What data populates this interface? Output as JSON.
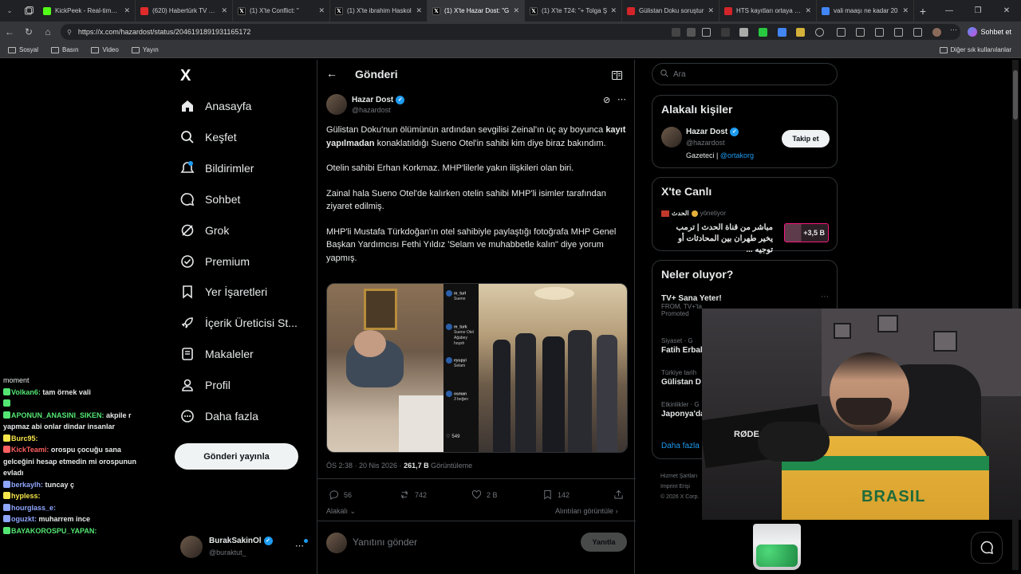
{
  "browser": {
    "tabs": [
      {
        "title": "KickPeek - Real-time U",
        "color": "#53fc18"
      },
      {
        "title": "(620) Habertürk TV Can",
        "color": "#e02b2b"
      },
      {
        "title": "(1) X'te Conflict: \"",
        "color": "#000000"
      },
      {
        "title": "(1) X'te ibrahim Haskol",
        "color": "#000000"
      },
      {
        "title": "(1) X'te Hazar Dost: \"G",
        "color": "#000000"
      },
      {
        "title": "(1) X'te T24: \"+ Tolga Ş",
        "color": "#000000"
      },
      {
        "title": "Gülistan Doku soruştur",
        "color": "#d3242a"
      },
      {
        "title": "HTS kayıtları ortaya çık",
        "color": "#d3242a"
      },
      {
        "title": "vali maaşı ne kadar 20",
        "color": "#4285f4"
      }
    ],
    "url": "https://x.com/hazardost/status/2046191891931165172",
    "chat_button": "Sohbet et",
    "bookmarks": [
      "Sosyal",
      "Basın",
      "Video",
      "Yayın"
    ],
    "bookmarks_other": "Diğer sık kullanılanlar"
  },
  "nav": {
    "logo": "X",
    "items": [
      {
        "label": "Anasayfa",
        "icon": "home-icon"
      },
      {
        "label": "Keşfet",
        "icon": "search-icon"
      },
      {
        "label": "Bildirimler",
        "icon": "bell-icon"
      },
      {
        "label": "Sohbet",
        "icon": "chat-icon"
      },
      {
        "label": "Grok",
        "icon": "grok-icon"
      },
      {
        "label": "Premium",
        "icon": "premium-icon"
      },
      {
        "label": "Yer İşaretleri",
        "icon": "bookmark-icon"
      },
      {
        "label": "İçerik Üreticisi St...",
        "icon": "rocket-icon"
      },
      {
        "label": "Makaleler",
        "icon": "article-icon"
      },
      {
        "label": "Profil",
        "icon": "profile-icon"
      },
      {
        "label": "Daha fazla",
        "icon": "more-icon"
      }
    ],
    "post_button": "Gönderi yayınla",
    "profile": {
      "name": "BurakSakinOl",
      "handle": "@buraktut_"
    }
  },
  "chat": [
    {
      "user": "",
      "text": "moment",
      "color": "#e7e9ea"
    },
    {
      "user": "Volkan6:",
      "text": " tam örnek vali",
      "color": "#54e673"
    },
    {
      "user": "",
      "text": "",
      "color": "#e7e9ea"
    },
    {
      "user": "APONUN_ANASINI_SIKEN:",
      "text": " akpile r yapmaz abi onlar dindar insanlar",
      "color": "#54e673"
    },
    {
      "user": "Burc95:",
      "text": "",
      "color": "#f7e64b"
    },
    {
      "user": "KickTeami:",
      "text": " orospu çocuğu sana gelceğini hesap etmedin mi orospunun evladı",
      "color": "#ff6060"
    },
    {
      "user": "berkaylh:",
      "text": " tuncay ç",
      "color": "#8fa6ff"
    },
    {
      "user": "hypless:",
      "text": "",
      "color": "#f7e64b"
    },
    {
      "user": "hourglass_e:",
      "text": "",
      "color": "#8fa6ff"
    },
    {
      "user": "oguzkt:",
      "text": " muharrem ince",
      "color": "#8fa6ff"
    },
    {
      "user": "BAYAKOROSPU_YAPAN:",
      "text": "",
      "color": "#54e673"
    }
  ],
  "post": {
    "header": "Gönderi",
    "author": "Hazar Dost",
    "handle": "@hazardost",
    "paragraphs": [
      {
        "pre": "Gülistan Doku'nun ölümünün ardından sevgilisi Zeinal'ın üç ay boyunca ",
        "bold": "kayıt yapılmadan",
        "post": " konaklatıldığı Sueno Otel'in sahibi kim diye biraz bakındım."
      },
      {
        "pre": "Otelin sahibi Erhan Korkmaz. MHP'lilerle yakın ilişkileri olan biri.",
        "bold": "",
        "post": ""
      },
      {
        "pre": "Zainal hala Sueno Otel'de kalırken otelin sahibi MHP'li isimler tarafından ziyaret edilmiş.",
        "bold": "",
        "post": ""
      },
      {
        "pre": "MHP'li Mustafa Türkdoğan'ın otel sahibiyle paylaştığı fotoğrafa MHP Genel Başkan Yardımcısı Fethi Yıldız 'Selam ve muhabbetle kalın\" diye yorum yapmış.",
        "bold": "",
        "post": ""
      }
    ],
    "image_comments": [
      {
        "user": "m_turl",
        "text": "Sueno"
      },
      {
        "user": "m_turk",
        "text": "Sueno Otel Ağabey hoşsh"
      },
      {
        "user": "eyupyi",
        "text": "Selam"
      },
      {
        "user": "osman",
        "text": "3 beğen"
      }
    ],
    "image_likes": "549",
    "time": "ÖS 2:38 · 20 Nis 2026 · ",
    "views": "261,7 B",
    "views_label": " Görüntüleme",
    "replies": "56",
    "reposts": "742",
    "likes": "2 B",
    "bookmarks": "142",
    "relevant": "Alakalı",
    "quotes": "Alıntıları görüntüle",
    "reply_placeholder": "Yanıtını gönder",
    "reply_button": "Yanıtla"
  },
  "right": {
    "search_placeholder": "Ara",
    "related_title": "Alakalı kişiler",
    "related": {
      "name": "Hazar Dost",
      "handle": "@hazardost",
      "bio": "Gazeteci | ",
      "bio_link": "@ortakorg",
      "follow": "Takip et"
    },
    "live_title": "X'te Canlı",
    "live": {
      "channel": "الحدث",
      "status": "yönetiyor",
      "text": "مباشر من قناة الحدث | ترمب يخير طهران بين المحادثات أو توجيه ...",
      "count": "+3,5 B"
    },
    "trends_title": "Neler oluyor?",
    "trends": [
      {
        "meta": "",
        "title": "TV+ Sana Yeter!",
        "sub": "FROM, TV+'ta",
        "extra": "Promoted"
      },
      {
        "meta": "Siyaset · G",
        "title": "Fatih Erbal",
        "sub": "",
        "extra": ""
      },
      {
        "meta": "Türkiye tarih",
        "title": "Gülistan D",
        "sub": "",
        "extra": ""
      },
      {
        "meta": "Etkinlikler · G",
        "title": "Japonya'da",
        "sub": "",
        "extra": ""
      }
    ],
    "more": "Daha fazla",
    "footer": [
      "Hizmet Şartları",
      "Imprint",
      "Erişi",
      "© 2026 X Corp."
    ]
  },
  "webcam": {
    "mic_brand": "RØDE",
    "shirt_text": "BRASIL"
  },
  "colors": {
    "x_blue": "#1d9bf0",
    "verified": "#1d9bf0",
    "border": "#2f3336",
    "muted": "#71767b",
    "live_pink": "#f91880"
  }
}
